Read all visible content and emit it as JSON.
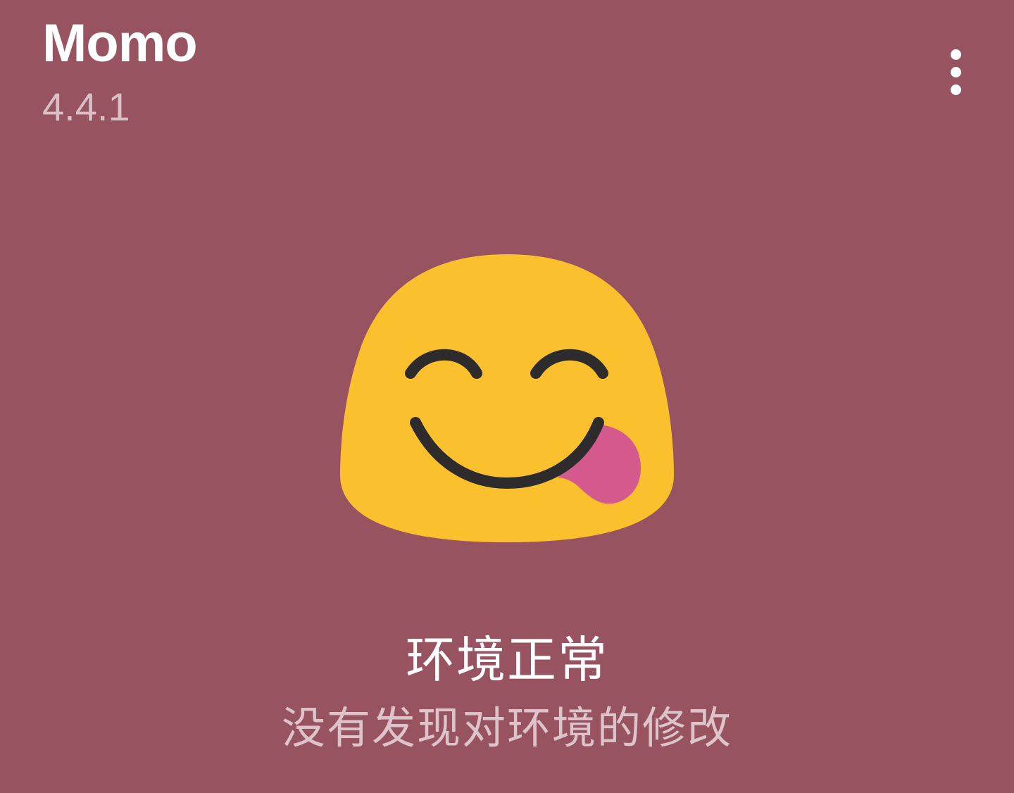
{
  "app": {
    "title": "Momo",
    "version": "4.4.1"
  },
  "toolbar": {
    "menu_icon": "more-vert-icon"
  },
  "status": {
    "icon": "face-savoring-food-emoji",
    "title": "环境正常",
    "description": "没有发现对环境的修改"
  },
  "colors": {
    "background": "#985360",
    "emoji_face": "#FBC02D",
    "emoji_features": "#2D2B2B",
    "emoji_tongue": "#D4598C"
  }
}
